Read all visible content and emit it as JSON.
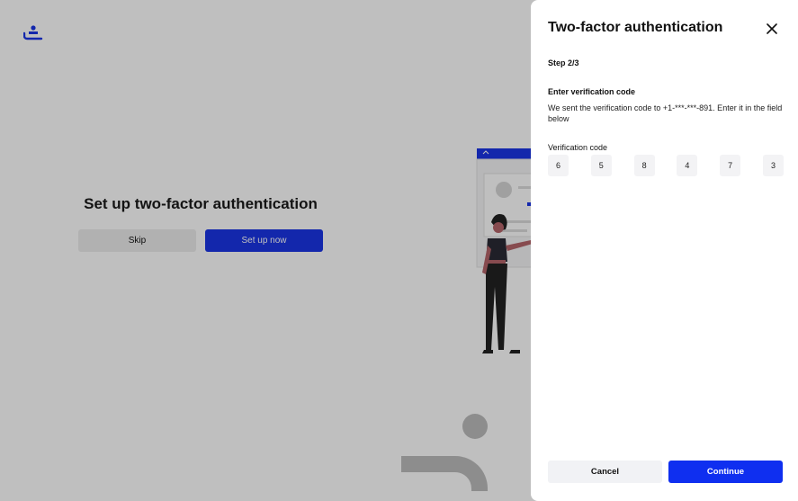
{
  "background": {
    "title": "Set up two-factor authentication",
    "skip_label": "Skip",
    "setup_label": "Set up now",
    "logo_icon": "brand-logo-icon",
    "accent": "#1a34e6"
  },
  "drawer": {
    "title": "Two-factor authentication",
    "close_icon": "close-icon",
    "step": "Step 2/3",
    "section_title": "Enter verification code",
    "section_desc": "We sent the verification code to +1-***-***-891. Enter it in the field below",
    "field_label": "Verification code",
    "code": [
      "6",
      "5",
      "8",
      "4",
      "7",
      "3"
    ],
    "cancel_label": "Cancel",
    "continue_label": "Continue",
    "primary_color": "#0f2ff0"
  }
}
